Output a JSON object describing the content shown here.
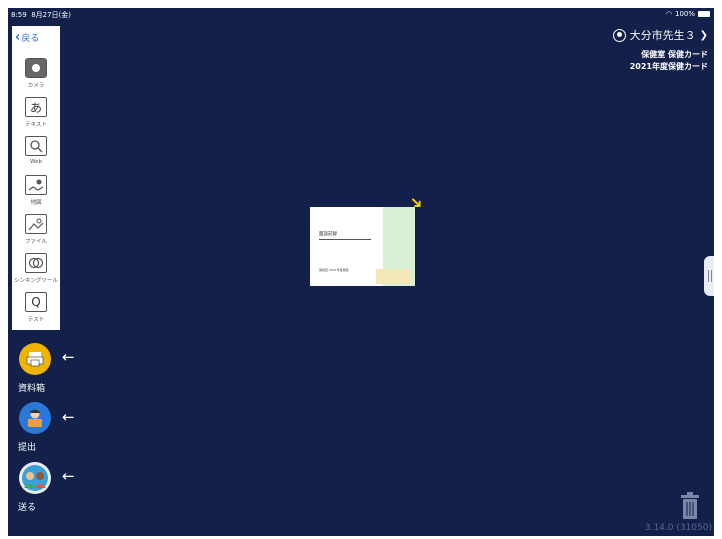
{
  "status_bar": {
    "time": "8:59",
    "date": "8月27日(金)",
    "battery": "100%"
  },
  "user": {
    "name": "大分市先生３",
    "class_line": "保健室 保健カード",
    "card_line": "2021年度保健カード"
  },
  "toolbar": {
    "back_label": "戻る",
    "tools": [
      {
        "label": "カメラ",
        "icon": "camera-icon"
      },
      {
        "label": "テキスト",
        "icon": "text-icon"
      },
      {
        "label": "Web",
        "icon": "search-icon"
      },
      {
        "label": "地図",
        "icon": "map-icon"
      },
      {
        "label": "ファイル",
        "icon": "image-icon"
      },
      {
        "label": "シンキングツール",
        "icon": "thinking-tool-icon"
      },
      {
        "label": "テスト",
        "icon": "test-icon"
      }
    ],
    "text_glyph": "あ",
    "test_glyph": "Q"
  },
  "side": {
    "materials_label": "資料箱",
    "submit_label": "提出",
    "send_label": "送る",
    "arrow": "←"
  },
  "card": {
    "title": "面談記録",
    "small_text": "保健室 2021年度保健"
  },
  "footer": {
    "version": "3.14.0 (31050)"
  },
  "colors": {
    "background": "#13204a",
    "accent_yellow": "#f5c300",
    "link_blue": "#2a6ad8"
  }
}
